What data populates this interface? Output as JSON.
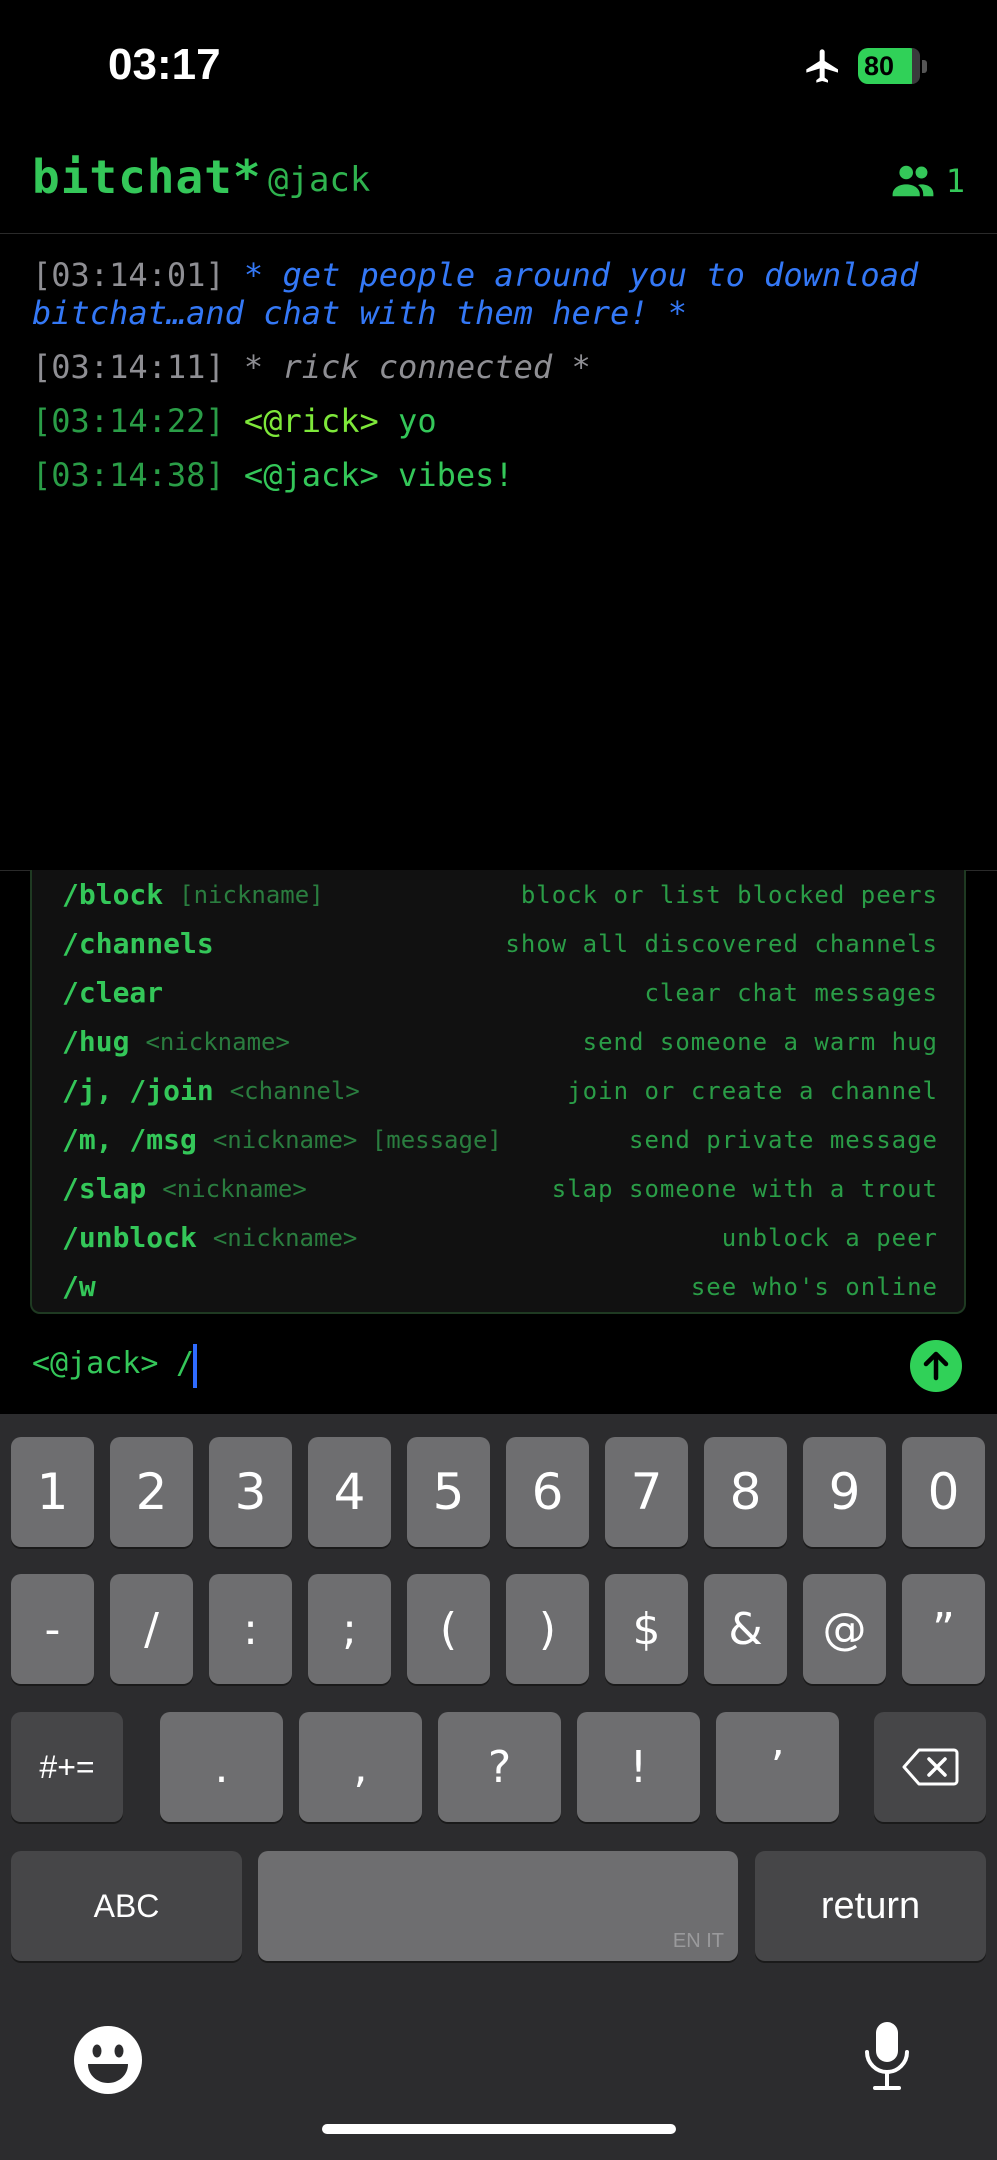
{
  "status_bar": {
    "time": "03:17",
    "battery": "80"
  },
  "header": {
    "app_name": "bitchat*",
    "nickname": "@jack",
    "peer_count": "1"
  },
  "messages": [
    {
      "timestamp": "[03:14:01]",
      "text": "* get people around you to download bitchat…and chat with them here! *"
    },
    {
      "timestamp": "[03:14:11]",
      "text": "* rick connected *"
    },
    {
      "timestamp": "[03:14:22]",
      "sender": "<@rick>",
      "text": "yo"
    },
    {
      "timestamp": "[03:14:38]",
      "sender": "<@jack>",
      "text": "vibes!"
    }
  ],
  "commands": [
    {
      "name": "/block",
      "args": "[nickname]",
      "desc": "block or list blocked peers"
    },
    {
      "name": "/channels",
      "args": "",
      "desc": "show all discovered channels"
    },
    {
      "name": "/clear",
      "args": "",
      "desc": "clear chat messages"
    },
    {
      "name": "/hug",
      "args": "<nickname>",
      "desc": "send someone a warm hug"
    },
    {
      "name": "/j, /join",
      "args": "<channel>",
      "desc": "join or create a channel"
    },
    {
      "name": "/m, /msg",
      "args": "<nickname> [message]",
      "desc": "send private message"
    },
    {
      "name": "/slap",
      "args": "<nickname>",
      "desc": "slap someone with a trout"
    },
    {
      "name": "/unblock",
      "args": "<nickname>",
      "desc": "unblock a peer"
    },
    {
      "name": "/w",
      "args": "",
      "desc": "see who's online"
    }
  ],
  "input": {
    "prompt": "<@jack>",
    "value": "/"
  },
  "keyboard": {
    "row1": [
      "1",
      "2",
      "3",
      "4",
      "5",
      "6",
      "7",
      "8",
      "9",
      "0"
    ],
    "row2": [
      "-",
      "/",
      ":",
      ";",
      "(",
      ")",
      "$",
      "&",
      "@",
      "”"
    ],
    "row3": [
      ".",
      ",",
      "?",
      "!",
      "’"
    ],
    "shift_label": "#+=",
    "abc_label": "ABC",
    "return_label": "return",
    "language": "EN IT"
  }
}
